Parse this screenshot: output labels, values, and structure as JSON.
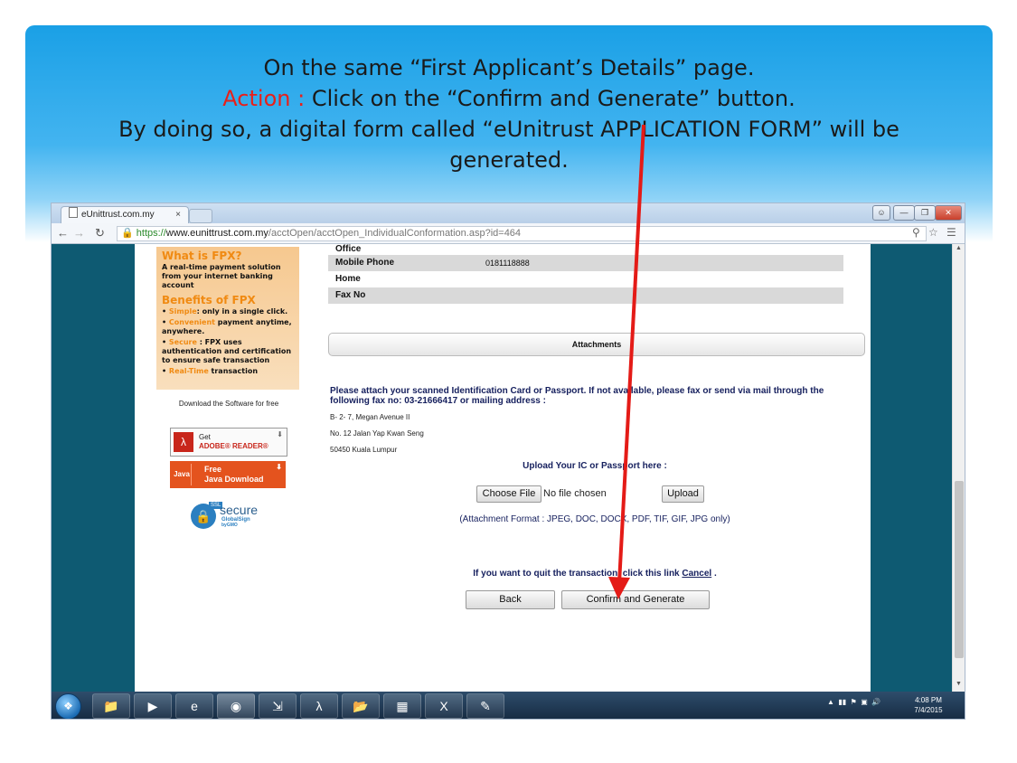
{
  "slide": {
    "line1": "On the same “First Applicant’s Details” page.",
    "action_label": "Action :",
    "action_text": " Click on the “Confirm and Generate” button.",
    "line3": "By doing so, a digital form called “eUnitrust APPLICATION FORM” will be",
    "line4": "generated."
  },
  "browser": {
    "tab_title": "eUnittrust.com.my",
    "tab_close": "×",
    "url_scheme": "https://",
    "url_host": "www.eunittrust.com.my",
    "url_path": "/acctOpen/acctOpen_IndividualConformation.asp?id=464"
  },
  "sidebar": {
    "fpx_title": "What is FPX?",
    "fpx_desc": "A real-time payment solution from your internet banking account",
    "benefits_title": "Benefits of FPX",
    "benefit1_key": "Simple",
    "benefit1_text": ": only in a single click.",
    "benefit2_key": "Convenient",
    "benefit2_text": " payment anytime, anywhere.",
    "benefit3_key": "Secure",
    "benefit3_text": " : FPX uses authentication and certification to ensure safe transaction",
    "benefit4_key": "Real-Time",
    "benefit4_text": " transaction",
    "download_label": "Download the Software for free",
    "adobe_get": "Get",
    "adobe_name": "ADOBE® READER®",
    "java_line1": "Free",
    "java_line2": "Java Download",
    "java_logo": "Java",
    "ssl_tag": "SSL",
    "ssl_secure": "secure",
    "ssl_globalsign": "GlobalSign",
    "ssl_gmo": "byGMO"
  },
  "contact_rows": [
    {
      "label": "Office",
      "value": ""
    },
    {
      "label": "Mobile Phone",
      "value": "0181118888"
    },
    {
      "label": "Home",
      "value": ""
    },
    {
      "label": "Fax No",
      "value": ""
    }
  ],
  "attachments": {
    "section_title": "Attachments",
    "note": "Please attach your scanned Identification Card or Passport. If not available,  please fax  or send via mail through the following fax no: 03-21666417 or mailing address :",
    "address_line1": "B- 2- 7, Megan Avenue II",
    "address_line2": "No. 12 Jalan Yap Kwan Seng",
    "address_line3": "50450 Kuala Lumpur",
    "upload_heading": "Upload Your IC or Passport here :",
    "choose_file_label": "Choose File",
    "file_status": "No file chosen",
    "upload_label": "Upload",
    "format_note": "(Attachment Format :  JPEG, DOC, DOCX, PDF, TIF, GIF, JPG only)"
  },
  "actions": {
    "quit_text": "If you want to quit the transaction, click this link",
    "cancel_link": "Cancel",
    "quit_suffix": " .",
    "back_label": "Back",
    "confirm_label": "Confirm and Generate"
  },
  "taskbar": {
    "time": "4:08 PM",
    "date": "7/4/2015"
  },
  "colors": {
    "action_red": "#e8201a",
    "fpx_orange": "#f08a12",
    "page_teal": "#0e5a72",
    "arrow_red": "#e41b17"
  }
}
